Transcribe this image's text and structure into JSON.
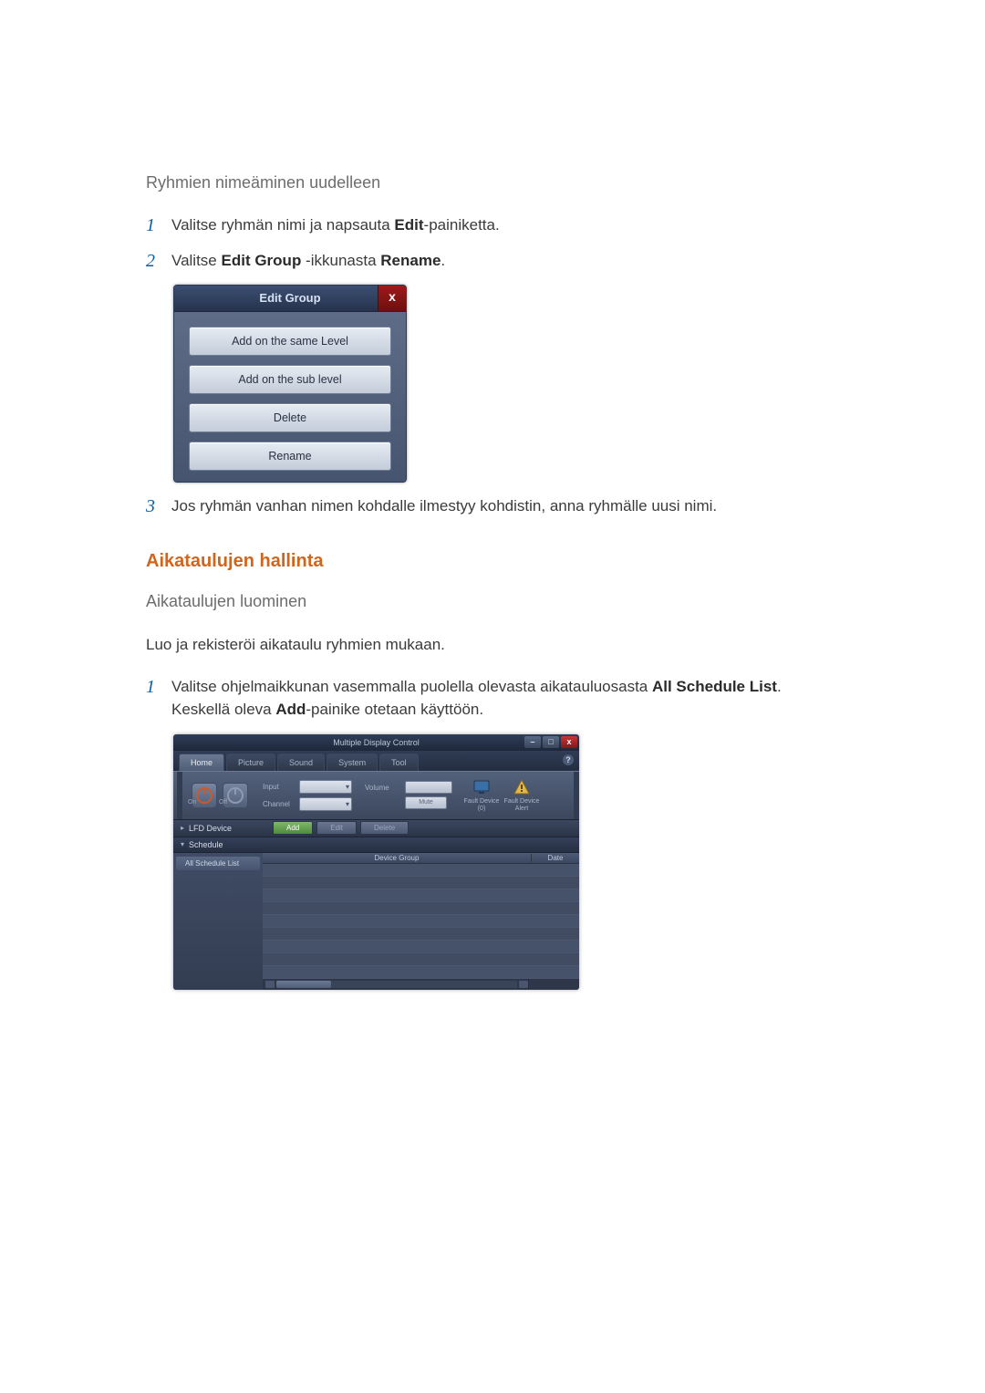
{
  "headings": {
    "renaming": "Ryhmien nimeäminen uudelleen",
    "schedules_section": "Aikataulujen hallinta",
    "schedules_sub": "Aikataulujen luominen"
  },
  "rename_steps": {
    "s1_a": "Valitse ryhmän nimi ja napsauta ",
    "s1_b": "Edit",
    "s1_c": "-painiketta.",
    "s2_a": "Valitse ",
    "s2_b": "Edit Group",
    "s2_c": " -ikkunasta ",
    "s2_d": "Rename",
    "s2_e": ".",
    "s3": "Jos ryhmän vanhan nimen kohdalle ilmestyy kohdistin, anna ryhmälle uusi nimi."
  },
  "edit_group_dialog": {
    "title": "Edit Group",
    "close": "x",
    "buttons": [
      "Add on the same Level",
      "Add on the sub level",
      "Delete",
      "Rename"
    ]
  },
  "schedules_intro": "Luo ja rekisteröi aikataulu ryhmien mukaan.",
  "schedule_steps": {
    "s1_a": "Valitse ohjelmaikkunan vasemmalla puolella olevasta aikatauluosasta ",
    "s1_b": "All Schedule List",
    "s1_c": ". Keskellä oleva ",
    "s1_d": "Add",
    "s1_e": "-painike otetaan käyttöön."
  },
  "mdc": {
    "title": "Multiple Display Control",
    "win": {
      "min": "–",
      "max": "□",
      "close": "x"
    },
    "tabs": [
      "Home",
      "Picture",
      "Sound",
      "System",
      "Tool"
    ],
    "help": "?",
    "power": {
      "on": "On",
      "off": "Off"
    },
    "inputs": {
      "input_label": "Input",
      "channel_label": "Channel"
    },
    "volume": {
      "label": "Volume",
      "mute": "Mute"
    },
    "fault": {
      "a": "Fault Device (0)",
      "b": "Fault Device Alert"
    },
    "row_labels": {
      "lfd": "LFD Device",
      "schedule": "Schedule"
    },
    "arrows": {
      "right": "▸",
      "down": "▾"
    },
    "toolbar": {
      "add": "Add",
      "edit": "Edit",
      "delete": "Delete"
    },
    "sidebar_item": "All Schedule List",
    "cols": {
      "group": "Device Group",
      "date": "Date"
    }
  },
  "nums": {
    "n1": "1",
    "n2": "2",
    "n3": "3"
  }
}
